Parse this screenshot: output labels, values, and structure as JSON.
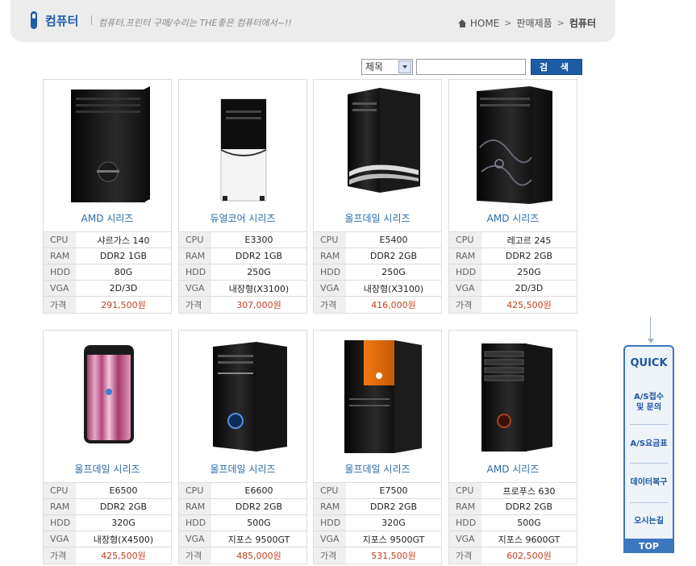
{
  "header": {
    "title": "컴퓨터",
    "subtitle": "컴퓨터,프린터 구매/수리는 THE좋은 컴퓨터에서~!!",
    "breadcrumb": [
      "HOME",
      "판매제품",
      "컴퓨터"
    ]
  },
  "search": {
    "select_value": "제목",
    "input_value": "",
    "button_label": "검 색"
  },
  "spec_labels": [
    "CPU",
    "RAM",
    "HDD",
    "VGA",
    "가격"
  ],
  "products": [
    {
      "name": "AMD 시리즈",
      "cpu": "샤르가스 140",
      "ram": "DDR2 1GB",
      "hdd": "80G",
      "vga": "2D/3D",
      "price": "291,500원"
    },
    {
      "name": "듀얼코어 시리즈",
      "cpu": "E3300",
      "ram": "DDR2 1GB",
      "hdd": "250G",
      "vga": "내장형(X3100)",
      "price": "307,000원"
    },
    {
      "name": "울프데일 시리즈",
      "cpu": "E5400",
      "ram": "DDR2 2GB",
      "hdd": "250G",
      "vga": "내장형(X3100)",
      "price": "416,000원"
    },
    {
      "name": "AMD 시리즈",
      "cpu": "레고르 245",
      "ram": "DDR2 2GB",
      "hdd": "250G",
      "vga": "2D/3D",
      "price": "425,500원"
    },
    {
      "name": "울프데일 시리즈",
      "cpu": "E6500",
      "ram": "DDR2 2GB",
      "hdd": "320G",
      "vga": "내장형(X4500)",
      "price": "425,500원"
    },
    {
      "name": "울프데일 시리즈",
      "cpu": "E6600",
      "ram": "DDR2 2GB",
      "hdd": "500G",
      "vga": "지포스 9500GT",
      "price": "485,000원"
    },
    {
      "name": "울프데일 시리즈",
      "cpu": "E7500",
      "ram": "DDR2 2GB",
      "hdd": "320G",
      "vga": "지포스 9500GT",
      "price": "531,500원"
    },
    {
      "name": "AMD 시리즈",
      "cpu": "프로푸스 630",
      "ram": "DDR2 2GB",
      "hdd": "500G",
      "vga": "지포스 9600GT",
      "price": "602,500원"
    }
  ],
  "quick": {
    "title": "QUICK",
    "items": [
      "A/S접수\n및 문의",
      "A/S요금표",
      "데이터복구",
      "오시는길"
    ],
    "top": "TOP"
  },
  "colors": {
    "accent": "#1f5ea8",
    "price": "#c0401e"
  }
}
